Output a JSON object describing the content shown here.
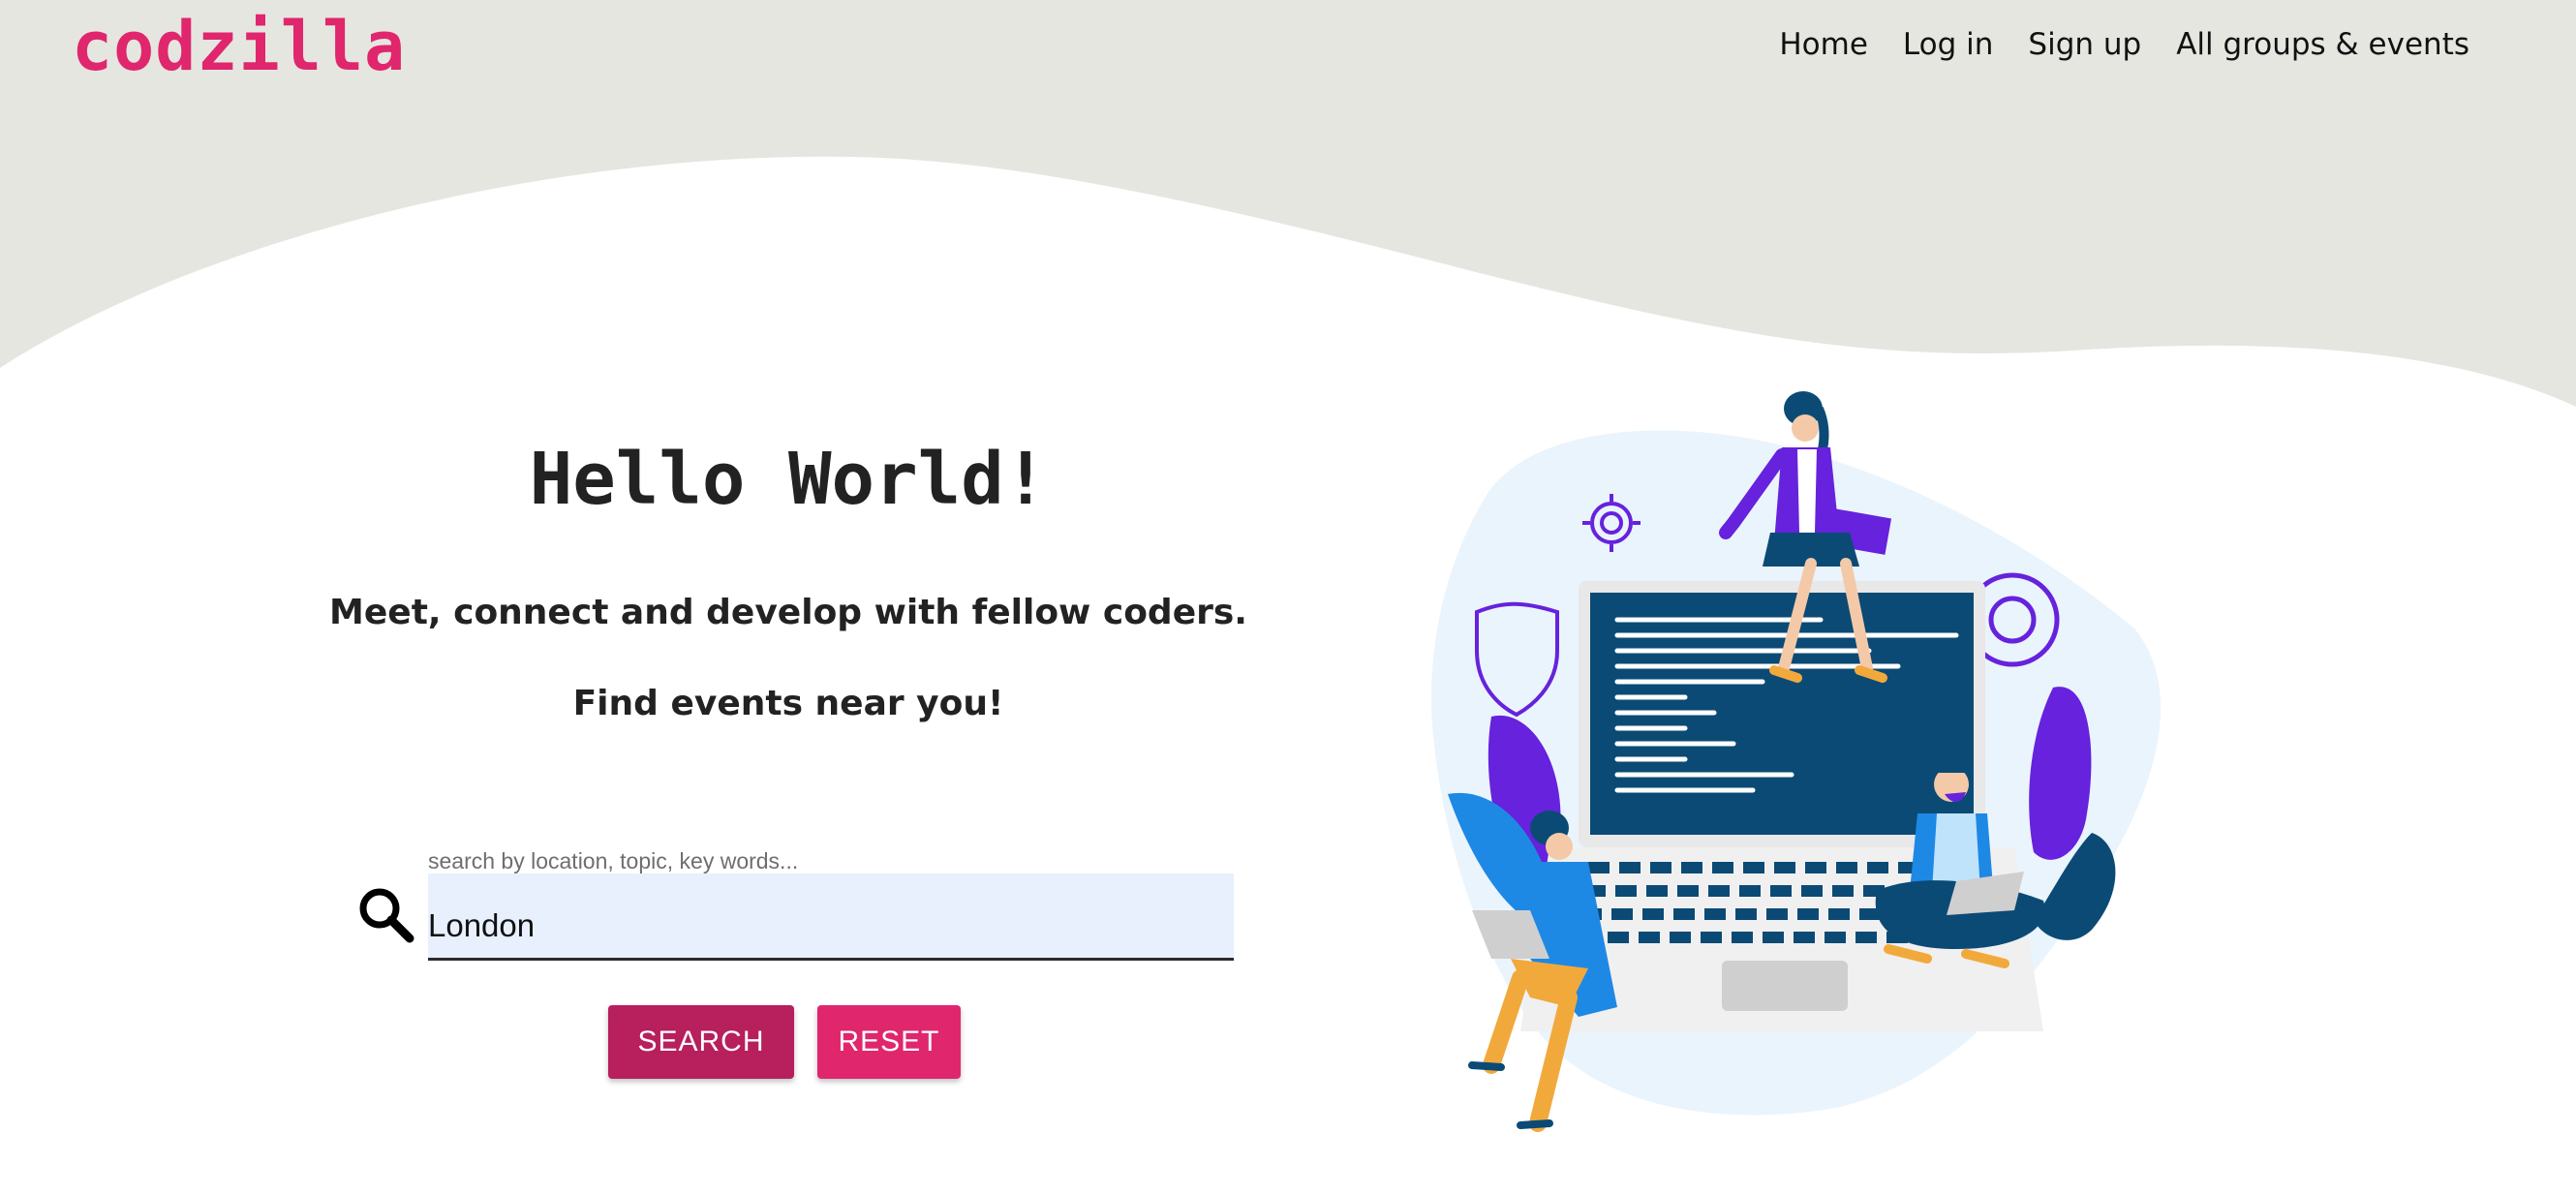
{
  "brand": {
    "name": "codzilla"
  },
  "nav": {
    "items": [
      {
        "label": "Home"
      },
      {
        "label": "Log in"
      },
      {
        "label": "Sign up"
      },
      {
        "label": "All groups & events"
      }
    ]
  },
  "hero": {
    "title": "Hello World!",
    "tagline": "Meet, connect and develop with fellow coders.",
    "subtagline": "Find events near you!"
  },
  "search": {
    "label": "search by location, topic, key words...",
    "value": "London",
    "search_button_label": "SEARCH",
    "reset_button_label": "RESET"
  },
  "icons": {
    "search": "search-icon",
    "illustration": "developers-laptop-illustration"
  },
  "colors": {
    "brand_pink": "#e0266d",
    "button_dark_pink": "#b71f5d",
    "hero_background": "#e6e6e1",
    "input_background": "#e8f0fe",
    "illustration_blue": "#0b4a75",
    "illustration_purple": "#6622dd"
  }
}
